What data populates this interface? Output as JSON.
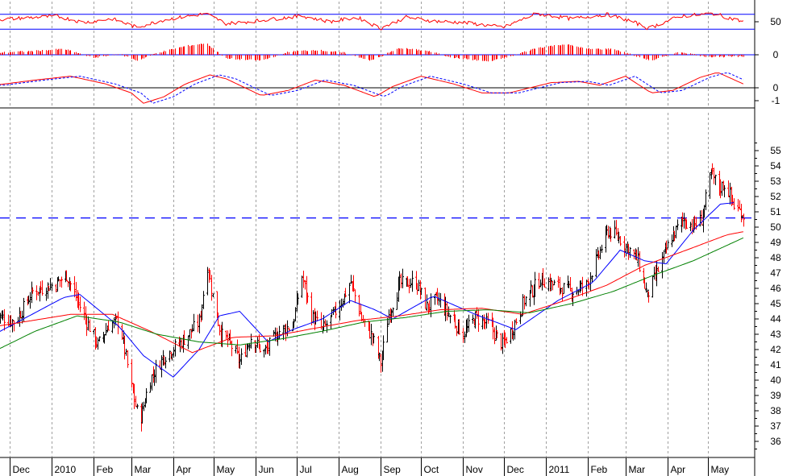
{
  "chart_data": {
    "type": "line",
    "title": "",
    "xlabel": "",
    "ylabel": "",
    "colors": {
      "up_bar": "#000000",
      "down_bar": "#ff0000",
      "ma_fast": "#0000ff",
      "ma_mid": "#ff0000",
      "ma_slow": "#008000",
      "indicator": "#ff0000",
      "reference_line": "#0000ff",
      "grid": "#a0a0a0",
      "frame": "#000000"
    },
    "x_labels": [
      {
        "label": "Dec",
        "date": "2009-12-01"
      },
      {
        "label": "2010",
        "date": "2010-01-01"
      },
      {
        "label": "Feb",
        "date": "2010-02-01"
      },
      {
        "label": "Mar",
        "date": "2010-03-01"
      },
      {
        "label": "Apr",
        "date": "2010-04-01"
      },
      {
        "label": "May",
        "date": "2010-05-01"
      },
      {
        "label": "Jun",
        "date": "2010-06-01"
      },
      {
        "label": "Jul",
        "date": "2010-07-01"
      },
      {
        "label": "Aug",
        "date": "2010-08-01"
      },
      {
        "label": "Sep",
        "date": "2010-09-01"
      },
      {
        "label": "Oct",
        "date": "2010-10-01"
      },
      {
        "label": "Nov",
        "date": "2010-11-01"
      },
      {
        "label": "Dec",
        "date": "2010-12-01"
      },
      {
        "label": "2011",
        "date": "2011-01-01"
      },
      {
        "label": "Feb",
        "date": "2011-02-01"
      },
      {
        "label": "Mar",
        "date": "2011-03-01"
      },
      {
        "label": "Apr",
        "date": "2011-04-01"
      },
      {
        "label": "May",
        "date": "2011-05-01"
      }
    ],
    "price_panel": {
      "ylim": [
        35,
        56
      ],
      "yticks": [
        "36",
        "37",
        "38",
        "39",
        "40",
        "41",
        "42",
        "43",
        "44",
        "45",
        "46",
        "47",
        "48",
        "49",
        "50",
        "51",
        "52",
        "53",
        "54",
        "55"
      ],
      "reference_level": 50.6,
      "grid": "vertical-dashed",
      "series": [
        {
          "kind": "price",
          "anchors": [
            [
              "2009-11-20",
              44.3
            ],
            [
              "2009-12-05",
              43.8
            ],
            [
              "2009-12-18",
              45.8
            ],
            [
              "2010-01-04",
              46.3
            ],
            [
              "2010-01-12",
              46.9
            ],
            [
              "2010-01-22",
              44.8
            ],
            [
              "2010-02-04",
              42.3
            ],
            [
              "2010-02-12",
              43.6
            ],
            [
              "2010-02-20",
              43.9
            ],
            [
              "2010-03-01",
              39.5
            ],
            [
              "2010-03-07",
              37.2
            ],
            [
              "2010-03-14",
              39.9
            ],
            [
              "2010-03-24",
              41.5
            ],
            [
              "2010-04-07",
              42.5
            ],
            [
              "2010-04-20",
              43.8
            ],
            [
              "2010-04-26",
              47.5
            ],
            [
              "2010-04-30",
              45.5
            ],
            [
              "2010-05-06",
              43.0
            ],
            [
              "2010-05-12",
              42.5
            ],
            [
              "2010-05-20",
              41.2
            ],
            [
              "2010-05-28",
              42.8
            ],
            [
              "2010-06-07",
              41.8
            ],
            [
              "2010-06-18",
              43.2
            ],
            [
              "2010-06-28",
              43.6
            ],
            [
              "2010-07-05",
              46.8
            ],
            [
              "2010-07-12",
              44.2
            ],
            [
              "2010-07-20",
              43.3
            ],
            [
              "2010-07-30",
              44.5
            ],
            [
              "2010-08-10",
              46.4
            ],
            [
              "2010-08-18",
              44.0
            ],
            [
              "2010-08-26",
              42.8
            ],
            [
              "2010-09-01",
              41.1
            ],
            [
              "2010-09-07",
              44.3
            ],
            [
              "2010-09-15",
              46.3
            ],
            [
              "2010-09-27",
              46.4
            ],
            [
              "2010-10-05",
              44.8
            ],
            [
              "2010-10-13",
              45.3
            ],
            [
              "2010-10-22",
              44.2
            ],
            [
              "2010-11-01",
              43.0
            ],
            [
              "2010-11-10",
              44.1
            ],
            [
              "2010-11-20",
              43.6
            ],
            [
              "2010-11-30",
              42.3
            ],
            [
              "2010-12-07",
              43.3
            ],
            [
              "2010-12-16",
              45.2
            ],
            [
              "2010-12-28",
              46.6
            ],
            [
              "2011-01-10",
              46.1
            ],
            [
              "2011-01-20",
              45.8
            ],
            [
              "2011-01-31",
              46.2
            ],
            [
              "2011-02-08",
              48.0
            ],
            [
              "2011-02-16",
              49.8
            ],
            [
              "2011-02-24",
              49.3
            ],
            [
              "2011-03-04",
              48.5
            ],
            [
              "2011-03-10",
              47.8
            ],
            [
              "2011-03-17",
              45.5
            ],
            [
              "2011-03-25",
              47.2
            ],
            [
              "2011-04-03",
              49.2
            ],
            [
              "2011-04-12",
              50.5
            ],
            [
              "2011-04-20",
              50.1
            ],
            [
              "2011-04-26",
              50.5
            ],
            [
              "2011-05-03",
              53.5
            ],
            [
              "2011-05-09",
              52.6
            ],
            [
              "2011-05-14",
              52.8
            ],
            [
              "2011-05-20",
              51.4
            ],
            [
              "2011-05-27",
              50.8
            ]
          ]
        },
        {
          "kind": "ma_fast",
          "anchors": [
            [
              "2009-11-20",
              43.0
            ],
            [
              "2010-01-10",
              45.4
            ],
            [
              "2010-01-22",
              45.6
            ],
            [
              "2010-02-20",
              43.5
            ],
            [
              "2010-03-10",
              41.6
            ],
            [
              "2010-04-01",
              40.2
            ],
            [
              "2010-04-20",
              42.0
            ],
            [
              "2010-05-05",
              44.2
            ],
            [
              "2010-05-20",
              44.5
            ],
            [
              "2010-06-10",
              42.5
            ],
            [
              "2010-06-28",
              43.3
            ],
            [
              "2010-07-20",
              44.0
            ],
            [
              "2010-08-10",
              45.2
            ],
            [
              "2010-08-28",
              44.6
            ],
            [
              "2010-09-10",
              44.0
            ],
            [
              "2010-10-10",
              45.5
            ],
            [
              "2010-11-10",
              44.3
            ],
            [
              "2010-12-10",
              43.3
            ],
            [
              "2011-01-10",
              45.2
            ],
            [
              "2011-02-05",
              46.4
            ],
            [
              "2011-02-25",
              48.5
            ],
            [
              "2011-03-15",
              47.8
            ],
            [
              "2011-03-31",
              47.6
            ],
            [
              "2011-04-20",
              49.8
            ],
            [
              "2011-05-10",
              51.5
            ],
            [
              "2011-05-20",
              51.6
            ]
          ]
        },
        {
          "kind": "ma_mid",
          "anchors": [
            [
              "2009-11-20",
              43.5
            ],
            [
              "2010-01-15",
              44.3
            ],
            [
              "2010-02-15",
              44.3
            ],
            [
              "2010-03-15",
              43.2
            ],
            [
              "2010-04-15",
              41.8
            ],
            [
              "2010-05-15",
              42.8
            ],
            [
              "2010-06-15",
              42.9
            ],
            [
              "2010-07-15",
              43.4
            ],
            [
              "2010-08-15",
              43.9
            ],
            [
              "2010-09-15",
              44.2
            ],
            [
              "2010-10-15",
              44.6
            ],
            [
              "2010-11-15",
              44.7
            ],
            [
              "2010-12-15",
              44.3
            ],
            [
              "2011-01-15",
              45.2
            ],
            [
              "2011-02-15",
              46.2
            ],
            [
              "2011-03-15",
              47.5
            ],
            [
              "2011-04-15",
              48.5
            ],
            [
              "2011-05-15",
              49.5
            ],
            [
              "2011-05-27",
              49.7
            ]
          ]
        },
        {
          "kind": "ma_slow",
          "anchors": [
            [
              "2009-11-20",
              41.9
            ],
            [
              "2009-12-20",
              43.2
            ],
            [
              "2010-01-20",
              44.2
            ],
            [
              "2010-02-20",
              43.8
            ],
            [
              "2010-03-20",
              43.0
            ],
            [
              "2010-04-20",
              42.5
            ],
            [
              "2010-05-20",
              42.3
            ],
            [
              "2010-06-20",
              42.7
            ],
            [
              "2010-07-20",
              43.2
            ],
            [
              "2010-08-20",
              43.8
            ],
            [
              "2010-09-20",
              44.1
            ],
            [
              "2010-10-20",
              44.5
            ],
            [
              "2010-11-20",
              44.6
            ],
            [
              "2010-12-20",
              44.4
            ],
            [
              "2011-01-20",
              45.0
            ],
            [
              "2011-02-20",
              45.8
            ],
            [
              "2011-03-20",
              46.8
            ],
            [
              "2011-04-20",
              47.8
            ],
            [
              "2011-05-27",
              49.3
            ]
          ]
        }
      ]
    },
    "indicator_panels": [
      {
        "kind": "oscillator",
        "yticks": [
          "50"
        ],
        "ylim": [
          0,
          100
        ],
        "upper_level": 70,
        "lower_level": 30,
        "anchors": [
          [
            "2009-11-20",
            55
          ],
          [
            "2009-12-10",
            60
          ],
          [
            "2010-01-05",
            65
          ],
          [
            "2010-01-25",
            48
          ],
          [
            "2010-02-15",
            58
          ],
          [
            "2010-03-05",
            35
          ],
          [
            "2010-03-25",
            55
          ],
          [
            "2010-04-25",
            72
          ],
          [
            "2010-05-10",
            45
          ],
          [
            "2010-06-01",
            52
          ],
          [
            "2010-07-05",
            66
          ],
          [
            "2010-07-25",
            50
          ],
          [
            "2010-08-15",
            62
          ],
          [
            "2010-09-01",
            32
          ],
          [
            "2010-09-20",
            62
          ],
          [
            "2010-10-10",
            52
          ],
          [
            "2010-11-01",
            48
          ],
          [
            "2010-12-01",
            35
          ],
          [
            "2010-12-25",
            72
          ],
          [
            "2011-01-20",
            58
          ],
          [
            "2011-02-15",
            70
          ],
          [
            "2011-03-05",
            52
          ],
          [
            "2011-03-18",
            32
          ],
          [
            "2011-04-10",
            65
          ],
          [
            "2011-05-05",
            72
          ],
          [
            "2011-05-27",
            50
          ]
        ]
      },
      {
        "kind": "histogram",
        "yticks": [
          "0"
        ],
        "ylim": [
          -1.5,
          1.5
        ],
        "anchors": [
          [
            "2009-11-20",
            0.2
          ],
          [
            "2009-12-20",
            0.4
          ],
          [
            "2010-01-10",
            0.6
          ],
          [
            "2010-02-01",
            -0.3
          ],
          [
            "2010-02-20",
            0.1
          ],
          [
            "2010-03-05",
            -0.6
          ],
          [
            "2010-03-20",
            0.2
          ],
          [
            "2010-04-10",
            0.9
          ],
          [
            "2010-04-25",
            1.2
          ],
          [
            "2010-05-10",
            -0.4
          ],
          [
            "2010-06-05",
            -0.6
          ],
          [
            "2010-06-25",
            0.3
          ],
          [
            "2010-07-15",
            0.5
          ],
          [
            "2010-08-05",
            0.2
          ],
          [
            "2010-08-25",
            -0.6
          ],
          [
            "2010-09-15",
            0.7
          ],
          [
            "2010-10-05",
            0.4
          ],
          [
            "2010-10-25",
            -0.3
          ],
          [
            "2010-11-20",
            -0.7
          ],
          [
            "2010-12-05",
            -0.2
          ],
          [
            "2010-12-25",
            0.7
          ],
          [
            "2011-01-15",
            1.1
          ],
          [
            "2011-02-01",
            0.6
          ],
          [
            "2011-02-20",
            0.6
          ],
          [
            "2011-03-10",
            -0.2
          ],
          [
            "2011-03-20",
            -0.6
          ],
          [
            "2011-04-10",
            0.3
          ],
          [
            "2011-04-30",
            -0.2
          ],
          [
            "2011-05-27",
            -0.2
          ]
        ]
      },
      {
        "kind": "macd",
        "yticks": [
          "0",
          "-1"
        ],
        "ylim": [
          -1.6,
          1.6
        ],
        "anchors": [
          [
            "2009-11-20",
            0.2
          ],
          [
            "2009-12-20",
            0.6
          ],
          [
            "2010-01-15",
            0.9
          ],
          [
            "2010-02-10",
            0.3
          ],
          [
            "2010-03-01",
            -0.4
          ],
          [
            "2010-03-10",
            -1.2
          ],
          [
            "2010-03-25",
            -0.7
          ],
          [
            "2010-04-10",
            0.3
          ],
          [
            "2010-04-28",
            1.0
          ],
          [
            "2010-05-10",
            0.7
          ],
          [
            "2010-06-05",
            -0.6
          ],
          [
            "2010-06-25",
            -0.2
          ],
          [
            "2010-07-15",
            0.6
          ],
          [
            "2010-08-05",
            0.2
          ],
          [
            "2010-08-28",
            -0.7
          ],
          [
            "2010-09-10",
            0.1
          ],
          [
            "2010-10-01",
            0.9
          ],
          [
            "2010-10-25",
            0.3
          ],
          [
            "2010-11-15",
            -0.4
          ],
          [
            "2010-12-05",
            -0.4
          ],
          [
            "2011-01-05",
            0.4
          ],
          [
            "2011-01-25",
            0.5
          ],
          [
            "2011-02-10",
            0.2
          ],
          [
            "2011-03-01",
            0.9
          ],
          [
            "2011-03-20",
            -0.4
          ],
          [
            "2011-04-05",
            -0.2
          ],
          [
            "2011-04-25",
            0.8
          ],
          [
            "2011-05-08",
            1.2
          ],
          [
            "2011-05-27",
            0.3
          ]
        ]
      }
    ]
  }
}
